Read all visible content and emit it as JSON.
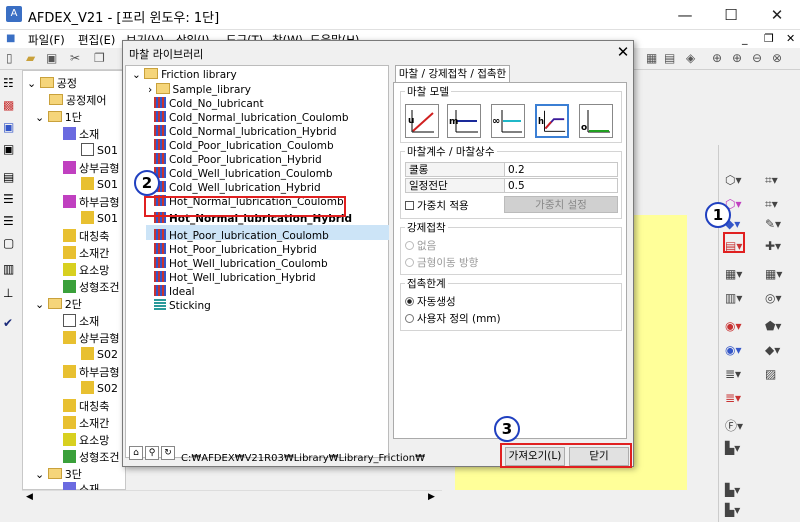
{
  "app": {
    "title": "AFDEX_V21 - [프리 윈도우: 1단]"
  },
  "menu": [
    "파일(F)",
    "편집(E)",
    "보기(V)",
    "삽입(I)",
    "도구(T)",
    "창(W)",
    "도움말(H)"
  ],
  "tree": {
    "items": [
      "공정",
      "공정제어",
      "1단",
      "소재",
      "S01",
      "상부금형",
      "S01",
      "하부금형",
      "S01",
      "대칭축",
      "소재간",
      "요소망",
      "성형조건",
      "2단",
      "소재",
      "상부금형",
      "S02",
      "하부금형",
      "S02",
      "대칭축",
      "소재간",
      "요소망",
      "성형조건",
      "3단",
      "소재"
    ]
  },
  "dialog": {
    "title": "마찰 라이브러리",
    "library": {
      "root": "Friction library",
      "items": [
        "Sample_library",
        "Cold_No_lubricant",
        "Cold_Normal_lubrication_Coulomb",
        "Cold_Normal_lubrication_Hybrid",
        "Cold_Poor_lubrication_Coulomb",
        "Cold_Poor_lubrication_Hybrid",
        "Cold_Well_lubrication_Coulomb",
        "Cold_Well_lubrication_Hybrid",
        "Hot_Normal_lubrication_Coulomb",
        "Hot_Normal_lubrication_Hybrid",
        "Hot_Poor_lubrication_Coulomb",
        "Hot_Poor_lubrication_Hybrid",
        "Hot_Well_lubrication_Coulomb",
        "Hot_Well_lubrication_Hybrid",
        "Ideal",
        "Sticking"
      ],
      "selected": "Hot_Normal_lubrication_Hybrid"
    },
    "path": "C:₩AFDEX₩V21R03₩Library₩Library_Friction₩",
    "tab_label": "마찰 / 강제접착 / 접촉한계",
    "model_group": "마찰 모델",
    "model_buttons": [
      "u",
      "m",
      "∞",
      "h",
      "o"
    ],
    "params_group": "마찰계수 / 마찰상수",
    "params": [
      {
        "label": "쿨롱",
        "value": "0.2"
      },
      {
        "label": "일정전단",
        "value": "0.5"
      }
    ],
    "weight_check": "가중치 적용",
    "weight_button": "가중치 설정",
    "force_group": "강제접착",
    "force_opts": [
      "없음",
      "금형이동 방향"
    ],
    "limit_group": "접촉한계",
    "limit_opts": [
      "자동생성",
      "사용자 정의 (mm)"
    ],
    "import_button": "가져오기(L)",
    "close_button": "닫기"
  },
  "annotations": [
    "1",
    "2",
    "3"
  ],
  "colors": {
    "highlight": "#e02020",
    "badge": "#2040c0",
    "selection": "#cce4f7",
    "canvas": "#ffff99"
  }
}
